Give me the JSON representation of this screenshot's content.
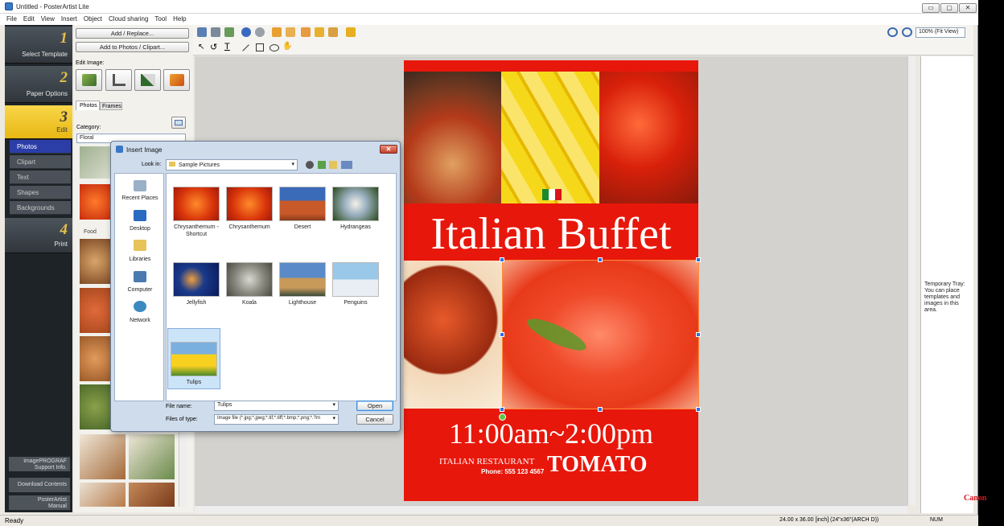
{
  "window": {
    "title": "Untitled - PosterArtist Lite",
    "min": "▭",
    "max": "▢",
    "close": "✕"
  },
  "menu": [
    "File",
    "Edit",
    "View",
    "Insert",
    "Object",
    "Cloud sharing",
    "Tool",
    "Help"
  ],
  "steps": [
    {
      "num": "1",
      "label": "Select Template"
    },
    {
      "num": "2",
      "label": "Paper Options"
    },
    {
      "num": "3",
      "label": "Edit"
    },
    {
      "num": "4",
      "label": "Print"
    }
  ],
  "edit_subitems": [
    "Photos",
    "Clipart",
    "Text",
    "Shapes",
    "Backgrounds"
  ],
  "bottom_buttons": [
    {
      "line1": "imagePROGRAF",
      "line2": "Support Info."
    },
    {
      "line1": "Download Contents",
      "line2": ""
    },
    {
      "line1": "PosterArtist",
      "line2": "Manual"
    }
  ],
  "panel": {
    "add_replace": "Add / Replace...",
    "add_photos": "Add to Photos / Clipart...",
    "edit_image": "Edit Image:",
    "tabs": [
      "Photos",
      "Frames"
    ],
    "category_label": "Category:",
    "category_value": "Floral",
    "food_label": "Food"
  },
  "zoom": "100% (Fit View)",
  "poster": {
    "title": "Italian Buffet",
    "time": "11:00am~2:00pm",
    "restaurant": "ITALIAN RESTAURANT",
    "name": "TOMATO",
    "phone": "Phone: 555 123 4567"
  },
  "tray_text": "Temporary Tray: You can place templates and images in this area.",
  "status": {
    "left": "Ready",
    "size": "24.00 x 36.00 [inch] (24\"x36\"(ARCH D))",
    "num": "NUM"
  },
  "brand": "Canon",
  "dialog": {
    "title": "Insert Image",
    "look_in_label": "Look in:",
    "look_in_value": "Sample Pictures",
    "places": [
      "Recent Places",
      "Desktop",
      "Libraries",
      "Computer",
      "Network"
    ],
    "files": [
      "Chrysanthemum - Shortcut",
      "Chrysanthemum",
      "Desert",
      "Hydrangeas",
      "Jellyfish",
      "Koala",
      "Lighthouse",
      "Penguins",
      "Tulips"
    ],
    "file_name_label": "File name:",
    "file_name_value": "Tulips",
    "file_type_label": "Files of type:",
    "file_type_value": "Image file (*.jpg;*.jpeg;*.tif;*.tiff;*.bmp;*.png;*.?m",
    "open": "Open",
    "cancel": "Cancel"
  },
  "colors": {
    "poster_red": "#e8170b",
    "nav_dark": "#1e2328",
    "active_step": "#f2c832",
    "selection": "#2b3ea8"
  }
}
